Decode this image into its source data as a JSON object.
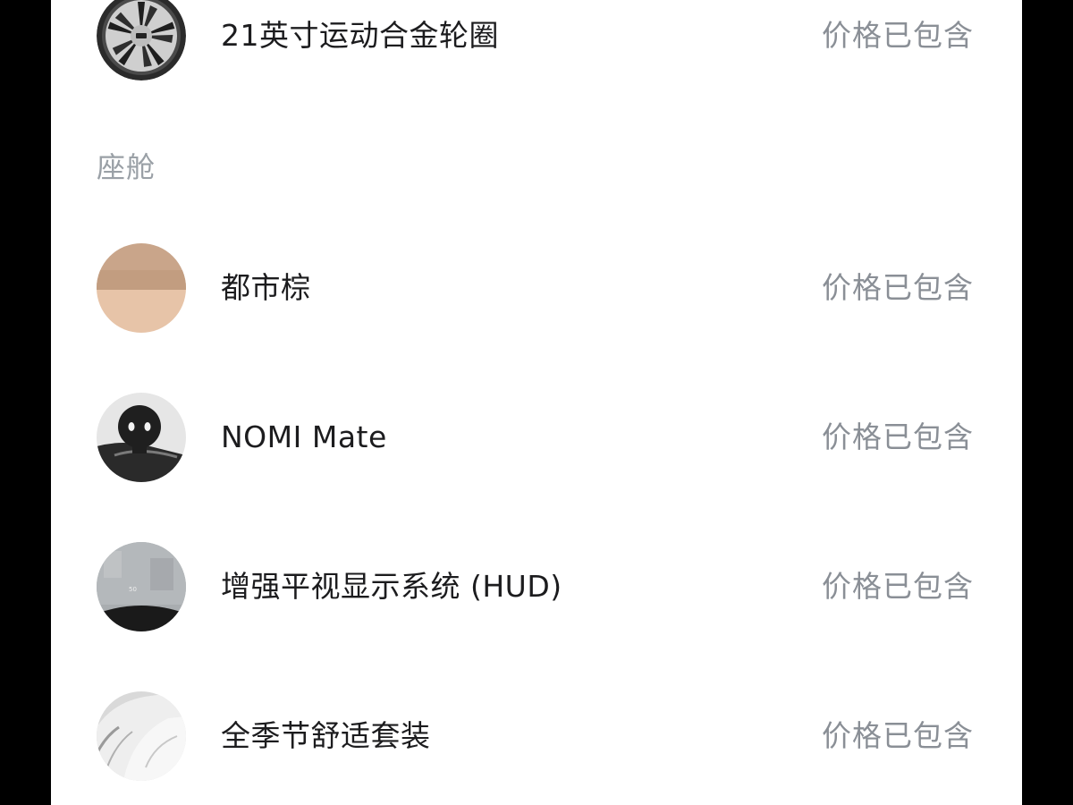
{
  "section_title": "座舱",
  "items": [
    {
      "label": "21英寸运动合金轮圈",
      "price": "价格已包含",
      "icon": "alloy-wheel-icon"
    },
    {
      "label": "都市棕",
      "price": "价格已包含",
      "icon": "brown-color-swatch"
    },
    {
      "label": "NOMI Mate",
      "price": "价格已包含",
      "icon": "nomi-mate-icon"
    },
    {
      "label": "增强平视显示系统 (HUD)",
      "price": "价格已包含",
      "icon": "hud-icon"
    },
    {
      "label": "全季节舒适套装",
      "price": "价格已包含",
      "icon": "seat-comfort-icon"
    }
  ]
}
